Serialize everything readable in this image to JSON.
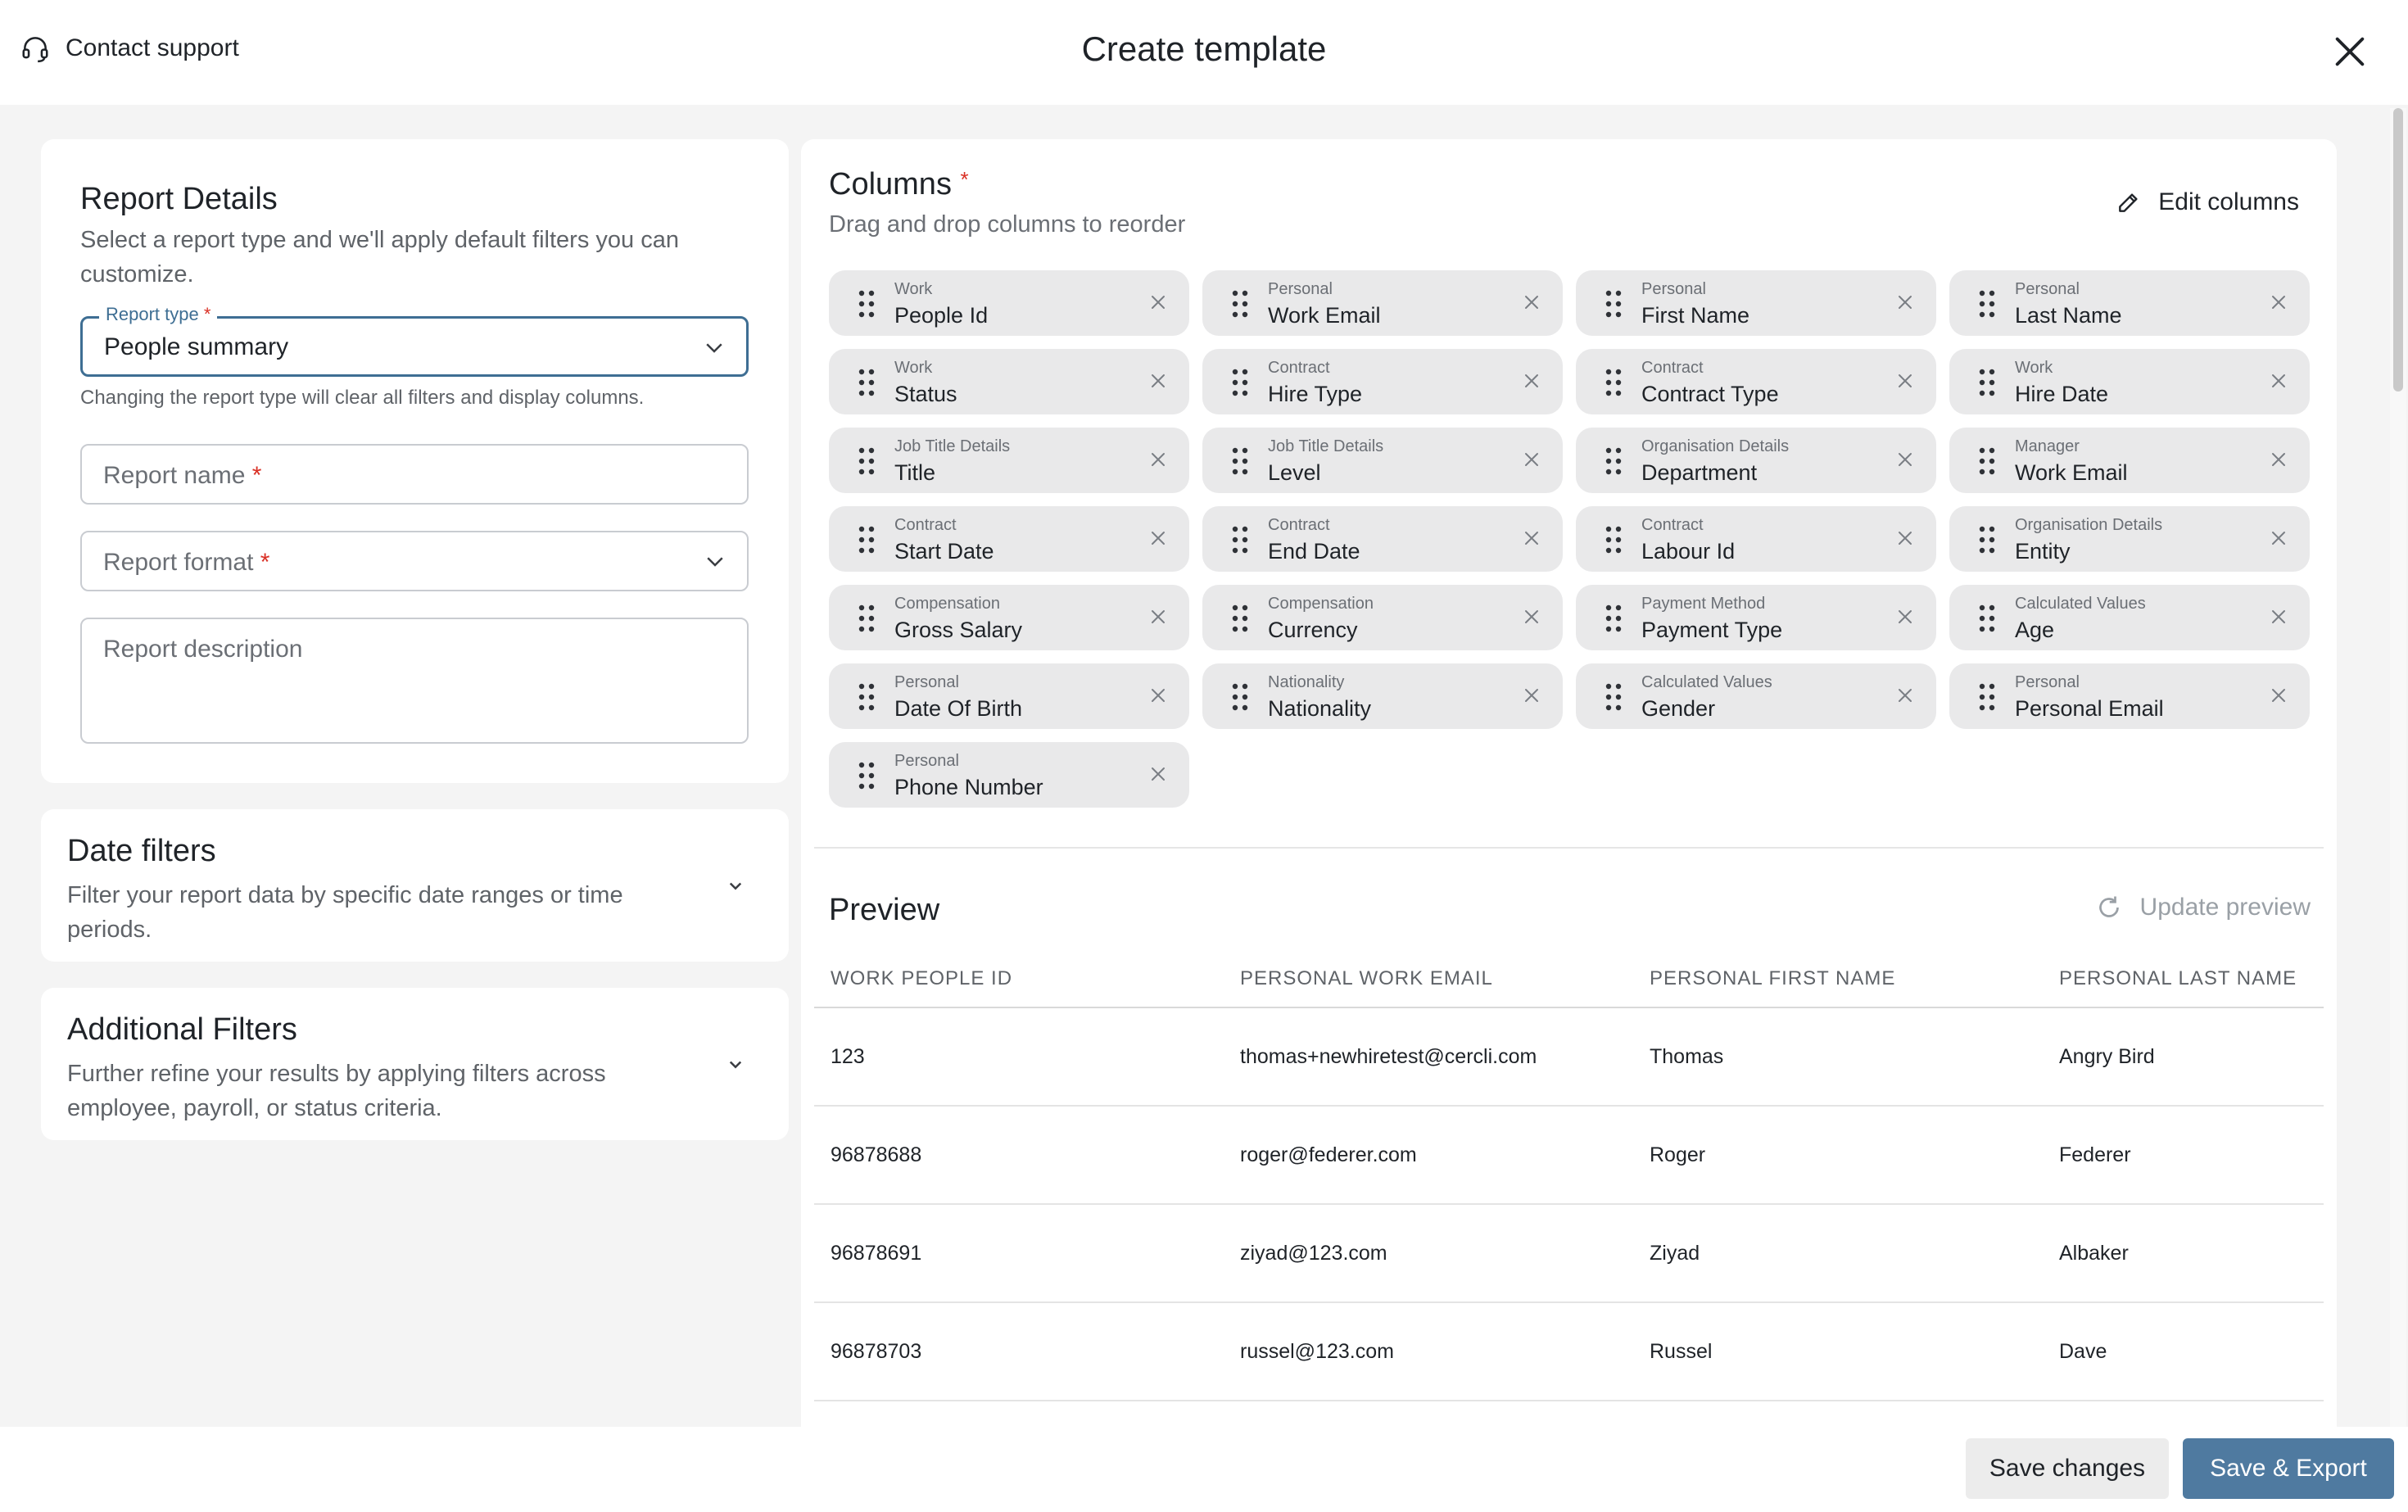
{
  "header": {
    "support_label": "Contact support",
    "title": "Create template"
  },
  "report_details": {
    "title": "Report Details",
    "subtitle": "Select a report type and we'll apply default filters you can customize.",
    "report_type_label": "Report type",
    "report_type_value": "People summary",
    "report_type_hint": "Changing the report type will clear all filters and display columns.",
    "report_name_placeholder": "Report name",
    "report_format_placeholder": "Report format",
    "report_description_placeholder": "Report description",
    "required_mark": "*"
  },
  "date_filters": {
    "title": "Date filters",
    "subtitle": "Filter your report data by specific date ranges or time periods."
  },
  "additional_filters": {
    "title": "Additional Filters",
    "subtitle": "Further refine your results by applying filters across employee, payroll, or status criteria."
  },
  "columns": {
    "title": "Columns",
    "required_mark": "*",
    "subtitle": "Drag and drop columns to reorder",
    "edit_label": "Edit columns",
    "items": [
      {
        "category": "Work",
        "name": "People Id"
      },
      {
        "category": "Personal",
        "name": "Work Email"
      },
      {
        "category": "Personal",
        "name": "First Name"
      },
      {
        "category": "Personal",
        "name": "Last Name"
      },
      {
        "category": "Work",
        "name": "Status"
      },
      {
        "category": "Contract",
        "name": "Hire Type"
      },
      {
        "category": "Contract",
        "name": "Contract Type"
      },
      {
        "category": "Work",
        "name": "Hire Date"
      },
      {
        "category": "Job Title Details",
        "name": "Title"
      },
      {
        "category": "Job Title Details",
        "name": "Level"
      },
      {
        "category": "Organisation Details",
        "name": "Department"
      },
      {
        "category": "Manager",
        "name": "Work Email"
      },
      {
        "category": "Contract",
        "name": "Start Date"
      },
      {
        "category": "Contract",
        "name": "End Date"
      },
      {
        "category": "Contract",
        "name": "Labour Id"
      },
      {
        "category": "Organisation Details",
        "name": "Entity"
      },
      {
        "category": "Compensation",
        "name": "Gross Salary"
      },
      {
        "category": "Compensation",
        "name": "Currency"
      },
      {
        "category": "Payment Method",
        "name": "Payment Type"
      },
      {
        "category": "Calculated Values",
        "name": "Age"
      },
      {
        "category": "Personal",
        "name": "Date Of Birth"
      },
      {
        "category": "Nationality",
        "name": "Nationality"
      },
      {
        "category": "Calculated Values",
        "name": "Gender"
      },
      {
        "category": "Personal",
        "name": "Personal Email"
      },
      {
        "category": "Personal",
        "name": "Phone Number"
      }
    ]
  },
  "preview": {
    "title": "Preview",
    "update_label": "Update preview",
    "headers": [
      "WORK PEOPLE ID",
      "PERSONAL WORK EMAIL",
      "PERSONAL FIRST NAME",
      "PERSONAL LAST NAME"
    ],
    "rows": [
      [
        "123",
        "thomas+newhiretest@cercli.com",
        "Thomas",
        "Angry Bird"
      ],
      [
        "96878688",
        "roger@federer.com",
        "Roger",
        "Federer"
      ],
      [
        "96878691",
        "ziyad@123.com",
        "Ziyad",
        "Albaker"
      ],
      [
        "96878703",
        "russel@123.com",
        "Russel",
        "Dave"
      ]
    ]
  },
  "footer": {
    "save_label": "Save changes",
    "save_export_label": "Save & Export"
  },
  "colors": {
    "accent": "#3e6e93",
    "primary_button": "#4f7aa0",
    "required": "#d93025",
    "chip_bg": "#e9e9ea"
  }
}
